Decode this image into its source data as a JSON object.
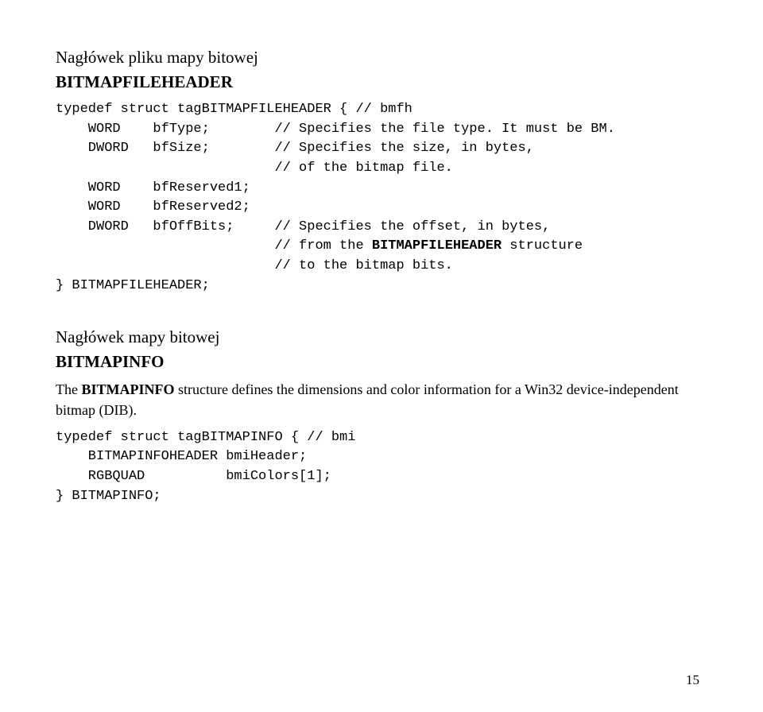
{
  "section1": {
    "heading": "Nagłówek pliku mapy bitowej",
    "subheading": "BITMAPFILEHEADER",
    "codeLines": [
      "typedef struct tagBITMAPFILEHEADER { // bmfh",
      "    WORD    bfType;        // Specifies the file type. It must be BM.",
      "    DWORD   bfSize;        // Specifies the size, in bytes,",
      "                           // of the bitmap file.",
      "    WORD    bfReserved1;",
      "    WORD    bfReserved2;",
      "    DWORD   bfOffBits;     // Specifies the offset, in bytes,"
    ],
    "codeBoldPrefix": "                           // from the ",
    "codeBoldWord": "BITMAPFILEHEADER",
    "codeBoldSuffix": " structure",
    "codeTail1": "                           // to the bitmap bits.",
    "codeTail2": "} BITMAPFILEHEADER;"
  },
  "section2": {
    "heading": "Nagłówek mapy bitowej",
    "subheading": "BITMAPINFO",
    "paraPrefix": "The ",
    "paraBold": "BITMAPINFO",
    "paraSuffix": " structure defines the dimensions and color information for a Win32 device-independent bitmap (DIB).",
    "codeLines": [
      "typedef struct tagBITMAPINFO { // bmi",
      "    BITMAPINFOHEADER bmiHeader;",
      "    RGBQUAD          bmiColors[1];",
      "} BITMAPINFO;"
    ]
  },
  "pageNumber": "15"
}
